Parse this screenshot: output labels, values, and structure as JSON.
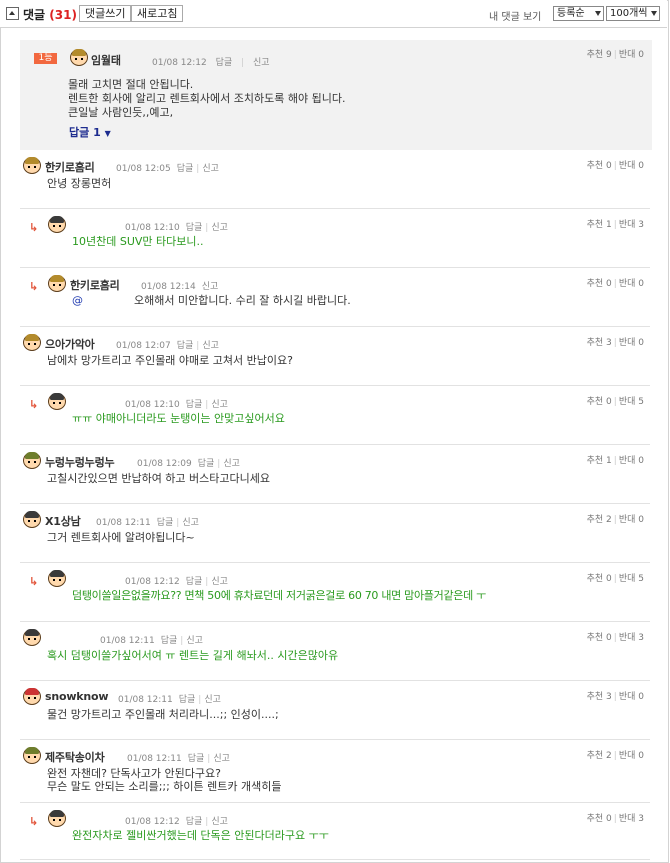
{
  "header": {
    "title": "댓글",
    "count": "(31)",
    "write_btn": "댓글쓰기",
    "refresh_btn": "새로고침",
    "my_comments": "내 댓글 보기",
    "sort_select": "등록순",
    "per_page_select": "100개씩"
  },
  "labels": {
    "reply": "답글",
    "report": "신고",
    "recommend": "추천",
    "oppose": "반대",
    "reply_arrow": "↳"
  },
  "best": {
    "rank": "1등",
    "author": "임월태",
    "date": "01/08 12:12",
    "reply_sep": "|",
    "recommend_count": "9",
    "oppose_count": "0",
    "lines": [
      "몰래 고치면 절대 안됩니다.",
      "렌트한 회사에 알리고 렌트회사에서 조치하도록 해야 됩니다.",
      "큰일날 사람인듯,,예고,"
    ],
    "reply_toggle": "답글 1",
    "reply_caret": "▼"
  },
  "comments": [
    {
      "author": "한키로흠리",
      "date": "01/08 12:05",
      "recommend": "0",
      "oppose": "0",
      "text": "안녕 장롱면허",
      "avatar": "av-tan"
    },
    {
      "author": "",
      "date": "01/08 12:10",
      "recommend": "1",
      "oppose": "3",
      "text": "10년찬데 SUV만 타다보니..",
      "avatar": "av-dark"
    },
    {
      "author": "한키로흠리",
      "date": "01/08 12:14",
      "recommend": "0",
      "oppose": "0",
      "mention": "@",
      "text": "오해해서 미안합니다. 수리 잘 하시길 바랍니다.",
      "avatar": "av-tan"
    },
    {
      "author": "으아가악아",
      "date": "01/08 12:07",
      "recommend": "3",
      "oppose": "0",
      "text": "남에차 망가트리고 주인몰래 야매로 고쳐서 반납이요?",
      "avatar": "av-tan"
    },
    {
      "author": "",
      "date": "01/08 12:10",
      "recommend": "0",
      "oppose": "5",
      "text": "ㅠㅠ 야매아니더라도 눈탱이는 안맞고싶어서요",
      "avatar": "av-dark"
    },
    {
      "author": "누렁누렁누렁누",
      "date": "01/08 12:09",
      "recommend": "1",
      "oppose": "0",
      "text": "고칠시간있으면 반납하여 하고 버스타고다니세요",
      "avatar": "av-green"
    },
    {
      "author": "X1상남",
      "date": "01/08 12:11",
      "recommend": "2",
      "oppose": "0",
      "text": "그거 렌트회사에 알려야됩니다~",
      "avatar": "av-dark"
    },
    {
      "author": "",
      "date": "01/08 12:12",
      "recommend": "0",
      "oppose": "5",
      "text": "덤탱이쓸일은없을까요?? 면책 50에 휴차료던데 저거굵은걸로 60 70 내면 맘아플거같은데 ㅜ",
      "avatar": "av-dark"
    },
    {
      "author": "",
      "date": "01/08 12:11",
      "recommend": "0",
      "oppose": "3",
      "text": "혹시 덤탱이쓸가싶어서여 ㅠ 렌트는 길게 해놔서.. 시간은많아유",
      "avatar": "av-dark"
    },
    {
      "author": "snowknow",
      "date": "01/08 12:11",
      "recommend": "3",
      "oppose": "0",
      "text": "물건 망가트리고 주인몰래 처리라니...;; 인성이....;",
      "avatar": "av-red"
    },
    {
      "author": "제주탁송이차",
      "date": "01/08 12:11",
      "recommend": "2",
      "oppose": "0",
      "text": "완전 자챈데? 단독사고가 안된다구요?",
      "text2": "무슨 말도 안되는 소리를;;; 하이튼 렌트카 개색히들",
      "avatar": "av-green"
    },
    {
      "author": "",
      "date": "01/08 12:12",
      "recommend": "0",
      "oppose": "3",
      "text": "완전자차로 젤비싼거했는데 단독은 안된다더라구요 ㅜㅜ",
      "avatar": "av-dark"
    }
  ]
}
